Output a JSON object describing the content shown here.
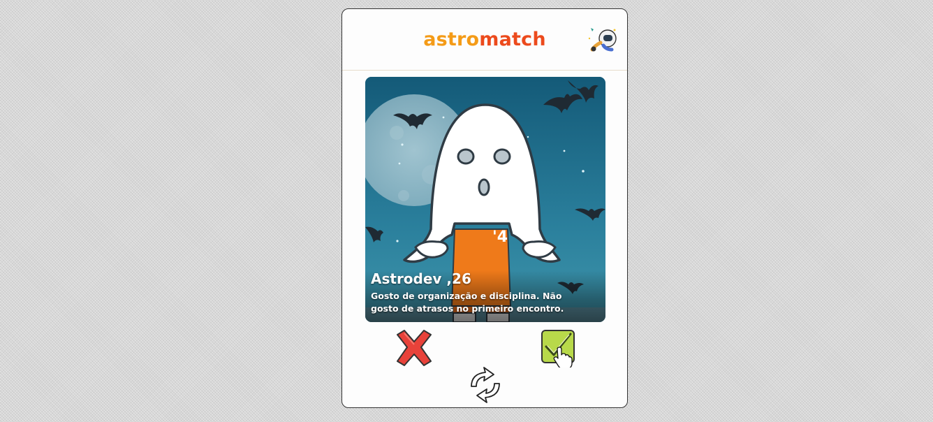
{
  "header": {
    "logo_part_1": "astro",
    "logo_part_2": "match",
    "matches_button_icon": "astronaut-icon"
  },
  "profile": {
    "name": "Astrodev ,26",
    "bio": "Gosto de organização e disciplina. Não gosto de atrasos no primeiro encontro.",
    "photo": "ghost-astrodev-illustration"
  },
  "actions": {
    "reject_icon": "red-x-icon",
    "accept_icon": "green-check-icon",
    "reset_icon": "refresh-arrows-icon"
  },
  "colors": {
    "logo_astro": "#f49b17",
    "logo_match": "#ec4a1c",
    "reject": "#e8423a",
    "accept": "#b8d94a",
    "photo_bg": "#1e5f7e"
  }
}
